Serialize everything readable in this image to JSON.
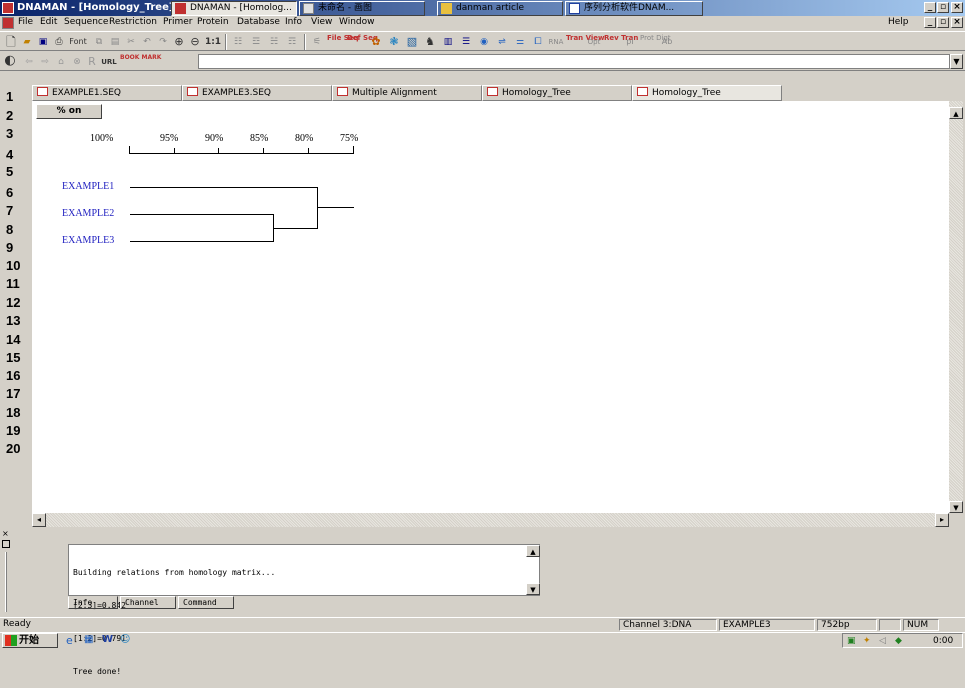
{
  "window": {
    "title": "DNAMAN - [Homology_Tree]",
    "minimize": "_",
    "restore": "▫",
    "close": "×"
  },
  "menu": {
    "items": [
      "File",
      "Edit",
      "Sequence",
      "Restriction",
      "Primer",
      "Protein",
      "Database",
      "Info",
      "View",
      "Window"
    ],
    "help": "Help"
  },
  "toolbar": {
    "font_label": "Font",
    "zoom_label": "1:1",
    "url_label": "URL",
    "book_label": "BOOK MARK",
    "file_seq": "File Seq",
    "def_seq": "Def Seq",
    "rna_label": "RNA",
    "tran_view": "Tran View",
    "opt_label": "Opt",
    "rev_tran": "Rev Tran",
    "pi_label": "pI",
    "prot_digt": "Prot Digt",
    "ab_label": "Ab"
  },
  "url": {
    "value": ""
  },
  "tabs": [
    "EXAMPLE1.SEQ",
    "EXAMPLE3.SEQ",
    "Multiple Alignment",
    "Homology_Tree",
    "Homology_Tree"
  ],
  "line_numbers": [
    "1",
    "2",
    "3",
    "4",
    "5",
    "6",
    "7",
    "8",
    "9",
    "10",
    "11",
    "12",
    "13",
    "14",
    "15",
    "16",
    "17",
    "18",
    "19",
    "20"
  ],
  "canvas": {
    "percent_button": "% on",
    "scale_labels": [
      "100%",
      "95%",
      "90%",
      "85%",
      "80%",
      "75%"
    ],
    "leaves": [
      "EXAMPLE1",
      "EXAMPLE2",
      "EXAMPLE3"
    ]
  },
  "output": {
    "lines": [
      "Building relations from homology matrix...",
      "[2:3]=0.842",
      "[1:2]=0.791",
      "Tree done!"
    ],
    "tabs": [
      "Info",
      "Channel",
      "Command"
    ]
  },
  "status": {
    "ready": "Ready",
    "channel": "Channel 3:DNA",
    "sequence": "EXAMPLE3",
    "length": "752bp",
    "blank": "",
    "num": "NUM"
  },
  "taskbar": {
    "start": "开始",
    "tasks": [
      "DNAMAN - [Homolog...",
      "未命名 - 画图",
      "danman article",
      "序列分析软件DNAM..."
    ],
    "clock": "0:00"
  },
  "colors": {
    "title_bar": "#0a246a",
    "leaf_text": "#2020c0",
    "chrome": "#d4d0c8"
  }
}
